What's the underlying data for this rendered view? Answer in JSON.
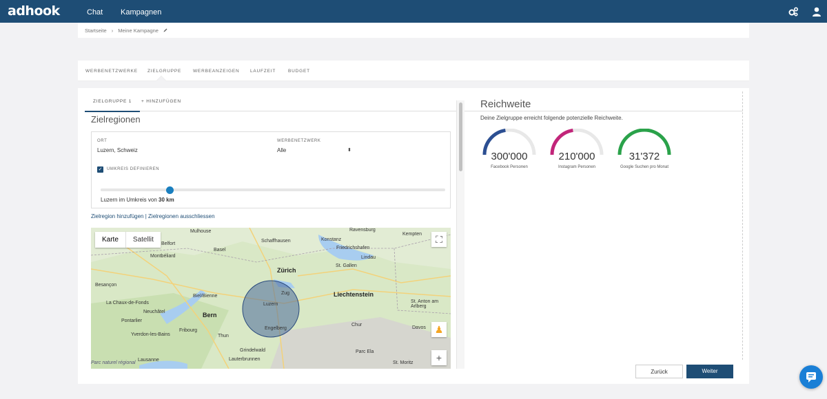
{
  "app": {
    "logo": "adhook"
  },
  "topnav": {
    "chat": "Chat",
    "campaigns": "Kampagnen"
  },
  "icons": {
    "settings": "gears-icon",
    "user": "user-icon",
    "chat": "chat-bubble-icon",
    "edit": "pencil-icon"
  },
  "breadcrumb": {
    "home": "Startseite",
    "sep": "›",
    "campaign": "Meine Kampagne"
  },
  "tabs": [
    "Werbenetzwerke",
    "Zielgruppe",
    "Werbeanzeigen",
    "Laufzeit",
    "Budget"
  ],
  "subtabs": {
    "group": "Zielgruppe 1",
    "add": "+ Hinzufügen"
  },
  "regions": {
    "title": "Zielregionen",
    "ort_label": "Ort",
    "ort_value": "Luzern, Schweiz",
    "network_label": "Werbenetzwerk",
    "network_value": "Alle",
    "checkbox_label": "Umkreis definieren",
    "radius_prefix": "Luzern im Umkreis von ",
    "radius_value": "30 km",
    "slider_fraction": 0.2,
    "link_add": "Zielregion hinzufügen",
    "link_sep": " | ",
    "link_exclude": "Zielregionen ausschliessen"
  },
  "map": {
    "karte": "Karte",
    "satellit": "Satellit",
    "cities": [
      {
        "name": "Mulhouse"
      },
      {
        "name": "Schaffhausen"
      },
      {
        "name": "Konstanz"
      },
      {
        "name": "Ravensburg"
      },
      {
        "name": "Belfort"
      },
      {
        "name": "Basel"
      },
      {
        "name": "Friedrichshafen"
      },
      {
        "name": "Kempten"
      },
      {
        "name": "Montbéliard"
      },
      {
        "name": "Lindau"
      },
      {
        "name": "Zürich"
      },
      {
        "name": "St. Gallen"
      },
      {
        "name": "Besançon"
      },
      {
        "name": "Zug"
      },
      {
        "name": "Liechtenstein"
      },
      {
        "name": "Luzern"
      },
      {
        "name": "Biel/Bienne"
      },
      {
        "name": "La Chaux-de-Fonds"
      },
      {
        "name": "Bern"
      },
      {
        "name": "Neuchâtel"
      },
      {
        "name": "Pontarlier"
      },
      {
        "name": "Chur"
      },
      {
        "name": "Fribourg"
      },
      {
        "name": "Yverdon-les-Bains"
      },
      {
        "name": "Thun"
      },
      {
        "name": "Engelberg"
      },
      {
        "name": "Davos"
      },
      {
        "name": "Lausanne"
      },
      {
        "name": "Parc Ela"
      },
      {
        "name": "Lauterbrunnen"
      },
      {
        "name": "Grindelwald"
      },
      {
        "name": "St. Anton am Arlberg"
      },
      {
        "name": "St. Moritz"
      },
      {
        "name": "Parc naturel régional"
      }
    ]
  },
  "reach": {
    "title": "Reichweite",
    "desc": "Deine Zielgruppe erreicht folgende potenzielle Reichweite.",
    "gauges": [
      {
        "value": "300'000",
        "label": "Facebook Personen",
        "color": "#2c4f92",
        "fill": 0.45
      },
      {
        "value": "210'000",
        "label": "Instagram Personen",
        "color": "#c2257a",
        "fill": 0.45
      },
      {
        "value": "31'372",
        "label": "Google Suchen pro Monat",
        "color": "#2aa24a",
        "fill": 1.0
      }
    ]
  },
  "buttons": {
    "back": "Zurück",
    "next": "Weiter"
  }
}
